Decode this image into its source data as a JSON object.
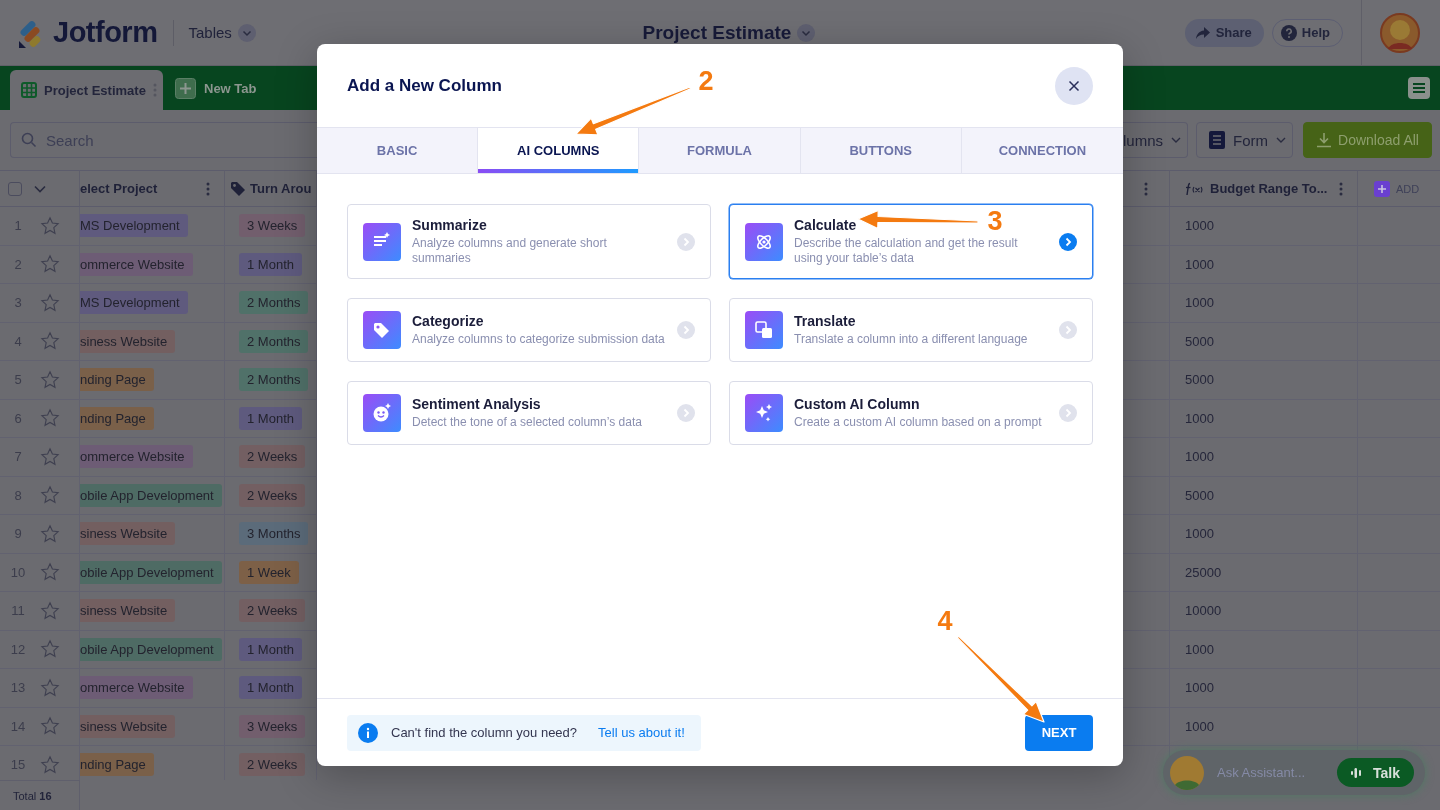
{
  "header": {
    "logo": "Jotform",
    "section": "Tables",
    "title": "Project Estimate",
    "share": "Share",
    "help": "Help"
  },
  "tab_bar": {
    "tabs": [
      {
        "label": "Project Estimate",
        "selected": true
      }
    ],
    "new_tab": "New Tab"
  },
  "toolbar": {
    "search_placeholder": "Search",
    "columns_button": "lumns",
    "form_button": "Form",
    "download_button": "Download All"
  },
  "table": {
    "header": {
      "checked": false,
      "project": "elect Project",
      "turnaround": "Turn Arou",
      "budget": "Budget Range To...",
      "add": "ADD"
    },
    "rows": [
      {
        "number": "1",
        "starred": false,
        "project": {
          "text": "MS Development",
          "color": "#5f5a7e"
        },
        "turnaround": {
          "text": "3 Weeks",
          "color": "#725e6d"
        },
        "budget": "1000"
      },
      {
        "number": "2",
        "starred": false,
        "project": {
          "text": "ommerce Website",
          "color": "#6d5c75"
        },
        "turnaround": {
          "text": "1 Month",
          "color": "#5e5a7e"
        },
        "budget": "1000"
      },
      {
        "number": "3",
        "starred": false,
        "project": {
          "text": "MS Development",
          "color": "#5f5a7e"
        },
        "turnaround": {
          "text": "2 Months",
          "color": "#507169"
        },
        "budget": "1000"
      },
      {
        "number": "4",
        "starred": false,
        "project": {
          "text": "siness Website",
          "color": "#735f60"
        },
        "turnaround": {
          "text": "2 Months",
          "color": "#507169"
        },
        "budget": "5000"
      },
      {
        "number": "5",
        "starred": false,
        "project": {
          "text": "nding Page",
          "color": "#7a6049"
        },
        "turnaround": {
          "text": "2 Months",
          "color": "#507169"
        },
        "budget": "5000"
      },
      {
        "number": "6",
        "starred": false,
        "project": {
          "text": "nding Page",
          "color": "#7a6049"
        },
        "turnaround": {
          "text": "1 Month",
          "color": "#5e5a7e"
        },
        "budget": "1000"
      },
      {
        "number": "7",
        "starred": false,
        "project": {
          "text": "ommerce Website",
          "color": "#6d5c75"
        },
        "turnaround": {
          "text": "2 Weeks",
          "color": "#735f62"
        },
        "budget": "1000"
      },
      {
        "number": "8",
        "starred": false,
        "project": {
          "text": "obile App Development",
          "color": "#4e6b64"
        },
        "turnaround": {
          "text": "2 Weeks",
          "color": "#735f62"
        },
        "budget": "5000"
      },
      {
        "number": "9",
        "starred": false,
        "project": {
          "text": "siness Website",
          "color": "#735f60"
        },
        "turnaround": {
          "text": "3 Months",
          "color": "#5b6b7a"
        },
        "budget": "1000"
      },
      {
        "number": "10",
        "starred": false,
        "project": {
          "text": "obile App Development",
          "color": "#4e6b64"
        },
        "turnaround": {
          "text": "1 Week",
          "color": "#7d6047"
        },
        "budget": "25000"
      },
      {
        "number": "11",
        "starred": false,
        "project": {
          "text": "siness Website",
          "color": "#735f60"
        },
        "turnaround": {
          "text": "2 Weeks",
          "color": "#735f62"
        },
        "budget": "10000"
      },
      {
        "number": "12",
        "starred": false,
        "project": {
          "text": "obile App Development",
          "color": "#4e6b64"
        },
        "turnaround": {
          "text": "1 Month",
          "color": "#5e5a7e"
        },
        "budget": "1000"
      },
      {
        "number": "13",
        "starred": false,
        "project": {
          "text": "ommerce Website",
          "color": "#6d5c75"
        },
        "turnaround": {
          "text": "1 Month",
          "color": "#5e5a7e"
        },
        "budget": "1000"
      },
      {
        "number": "14",
        "starred": false,
        "project": {
          "text": "siness Website",
          "color": "#735f60"
        },
        "turnaround": {
          "text": "3 Weeks",
          "color": "#725e6d"
        },
        "budget": "1000"
      },
      {
        "number": "15",
        "starred": false,
        "project": {
          "text": "nding Page",
          "color": "#7a6049"
        },
        "turnaround": {
          "text": "2 Weeks",
          "color": "#735f62"
        }
      }
    ],
    "footer": "Total **16**"
  },
  "modal": {
    "title": "Add a New Column",
    "tabs": [
      {
        "label": "BASIC",
        "selected": false
      },
      {
        "label": "AI COLUMNS",
        "selected": true
      },
      {
        "label": "FORMULA",
        "selected": false
      },
      {
        "label": "BUTTONS",
        "selected": false
      },
      {
        "label": "CONNECTION",
        "selected": false
      }
    ],
    "options": [
      {
        "kind": "summarize",
        "title": "Summarize",
        "description": "Analyze columns and generate short summaries",
        "selected": false
      },
      {
        "kind": "calculate",
        "title": "Calculate",
        "description": "Describe the calculation and get the result using your table’s data",
        "selected": true
      },
      {
        "kind": "categorize",
        "title": "Categorize",
        "description": "Analyze columns to categorize submission data",
        "selected": false
      },
      {
        "kind": "translate",
        "title": "Translate",
        "description": "Translate a column into a different language",
        "selected": false
      },
      {
        "kind": "sentiment",
        "title": "Sentiment Analysis",
        "description": "Detect the tone of a selected column’s data",
        "selected": false
      },
      {
        "kind": "custom",
        "title": "Custom AI Column",
        "description": "Create a custom AI column based on a prompt",
        "selected": false
      }
    ],
    "info": {
      "text": "Can't find the column you need?",
      "link": "Tell us about it!"
    },
    "next_button": "NEXT"
  },
  "annotations": [
    {
      "number": "2"
    },
    {
      "number": "3"
    },
    {
      "number": "4"
    }
  ],
  "assistant": {
    "placeholder": "Ask Assistant...",
    "talk": "Talk"
  }
}
